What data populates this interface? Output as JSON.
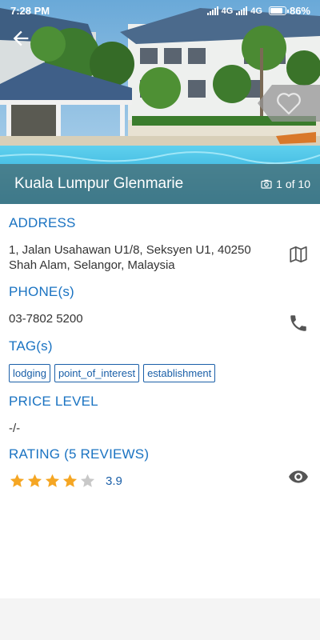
{
  "status_bar": {
    "time": "7:28 PM",
    "network_1": "4G",
    "network_2": "4G",
    "battery": "86%"
  },
  "place": {
    "name": "Kuala Lumpur Glenmarie",
    "photo_counter": "1 of 10"
  },
  "sections": {
    "address": {
      "label": "ADDRESS",
      "line1": "1, Jalan Usahawan U1/8, Seksyen U1, 40250",
      "line2": "Shah Alam, Selangor, Malaysia"
    },
    "phone": {
      "label": "PHONE(s)",
      "value": "03-7802 5200"
    },
    "tags": {
      "label": "TAG(s)",
      "items": [
        "lodging",
        "point_of_interest",
        "establishment"
      ]
    },
    "price": {
      "label": "PRICE LEVEL",
      "value": "-/-"
    },
    "rating": {
      "label": "RATING (5 REVIEWS)",
      "value": "3.9",
      "stars_filled": 4,
      "stars_total": 5
    }
  },
  "icons": {
    "back": "arrow-back-icon",
    "favorite": "heart-icon",
    "camera": "camera-icon",
    "map": "map-icon",
    "phone": "phone-icon",
    "view": "eye-icon"
  },
  "colors": {
    "accent": "#1a73c2",
    "star": "#f5a623",
    "star_empty": "#c8c8c8",
    "title_overlay": "#486e76"
  }
}
